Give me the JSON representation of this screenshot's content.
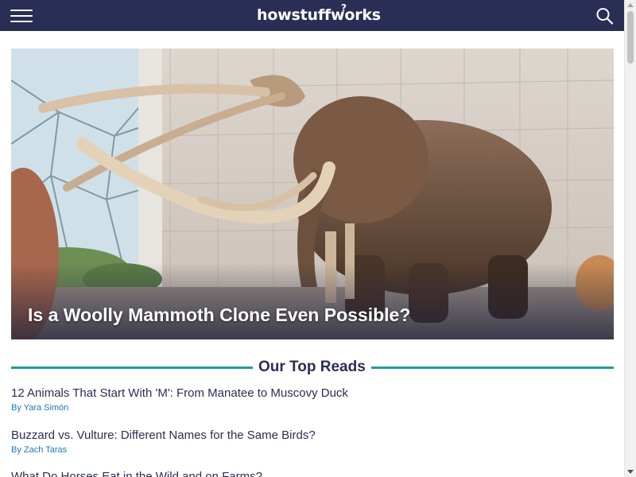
{
  "header": {
    "logo": "howstuffworks",
    "logo_mark": "?",
    "menu_icon": "hamburger-menu-icon",
    "search_icon": "search-icon",
    "background_color": "#2a2e55"
  },
  "hero": {
    "title": "Is a Woolly Mammoth Clone Even Possible?"
  },
  "top_reads": {
    "heading": "Our Top Reads",
    "accent_color": "#1f9c9b",
    "articles": [
      {
        "title": "12 Animals That Start With 'M': From Manatee to Muscovy Duck",
        "byline": "By Yara Simón"
      },
      {
        "title": "Buzzard vs. Vulture: Different Names for the Same Birds?",
        "byline": "By Zach Taras"
      },
      {
        "title": "What Do Horses Eat in the Wild and on Farms?"
      }
    ]
  }
}
